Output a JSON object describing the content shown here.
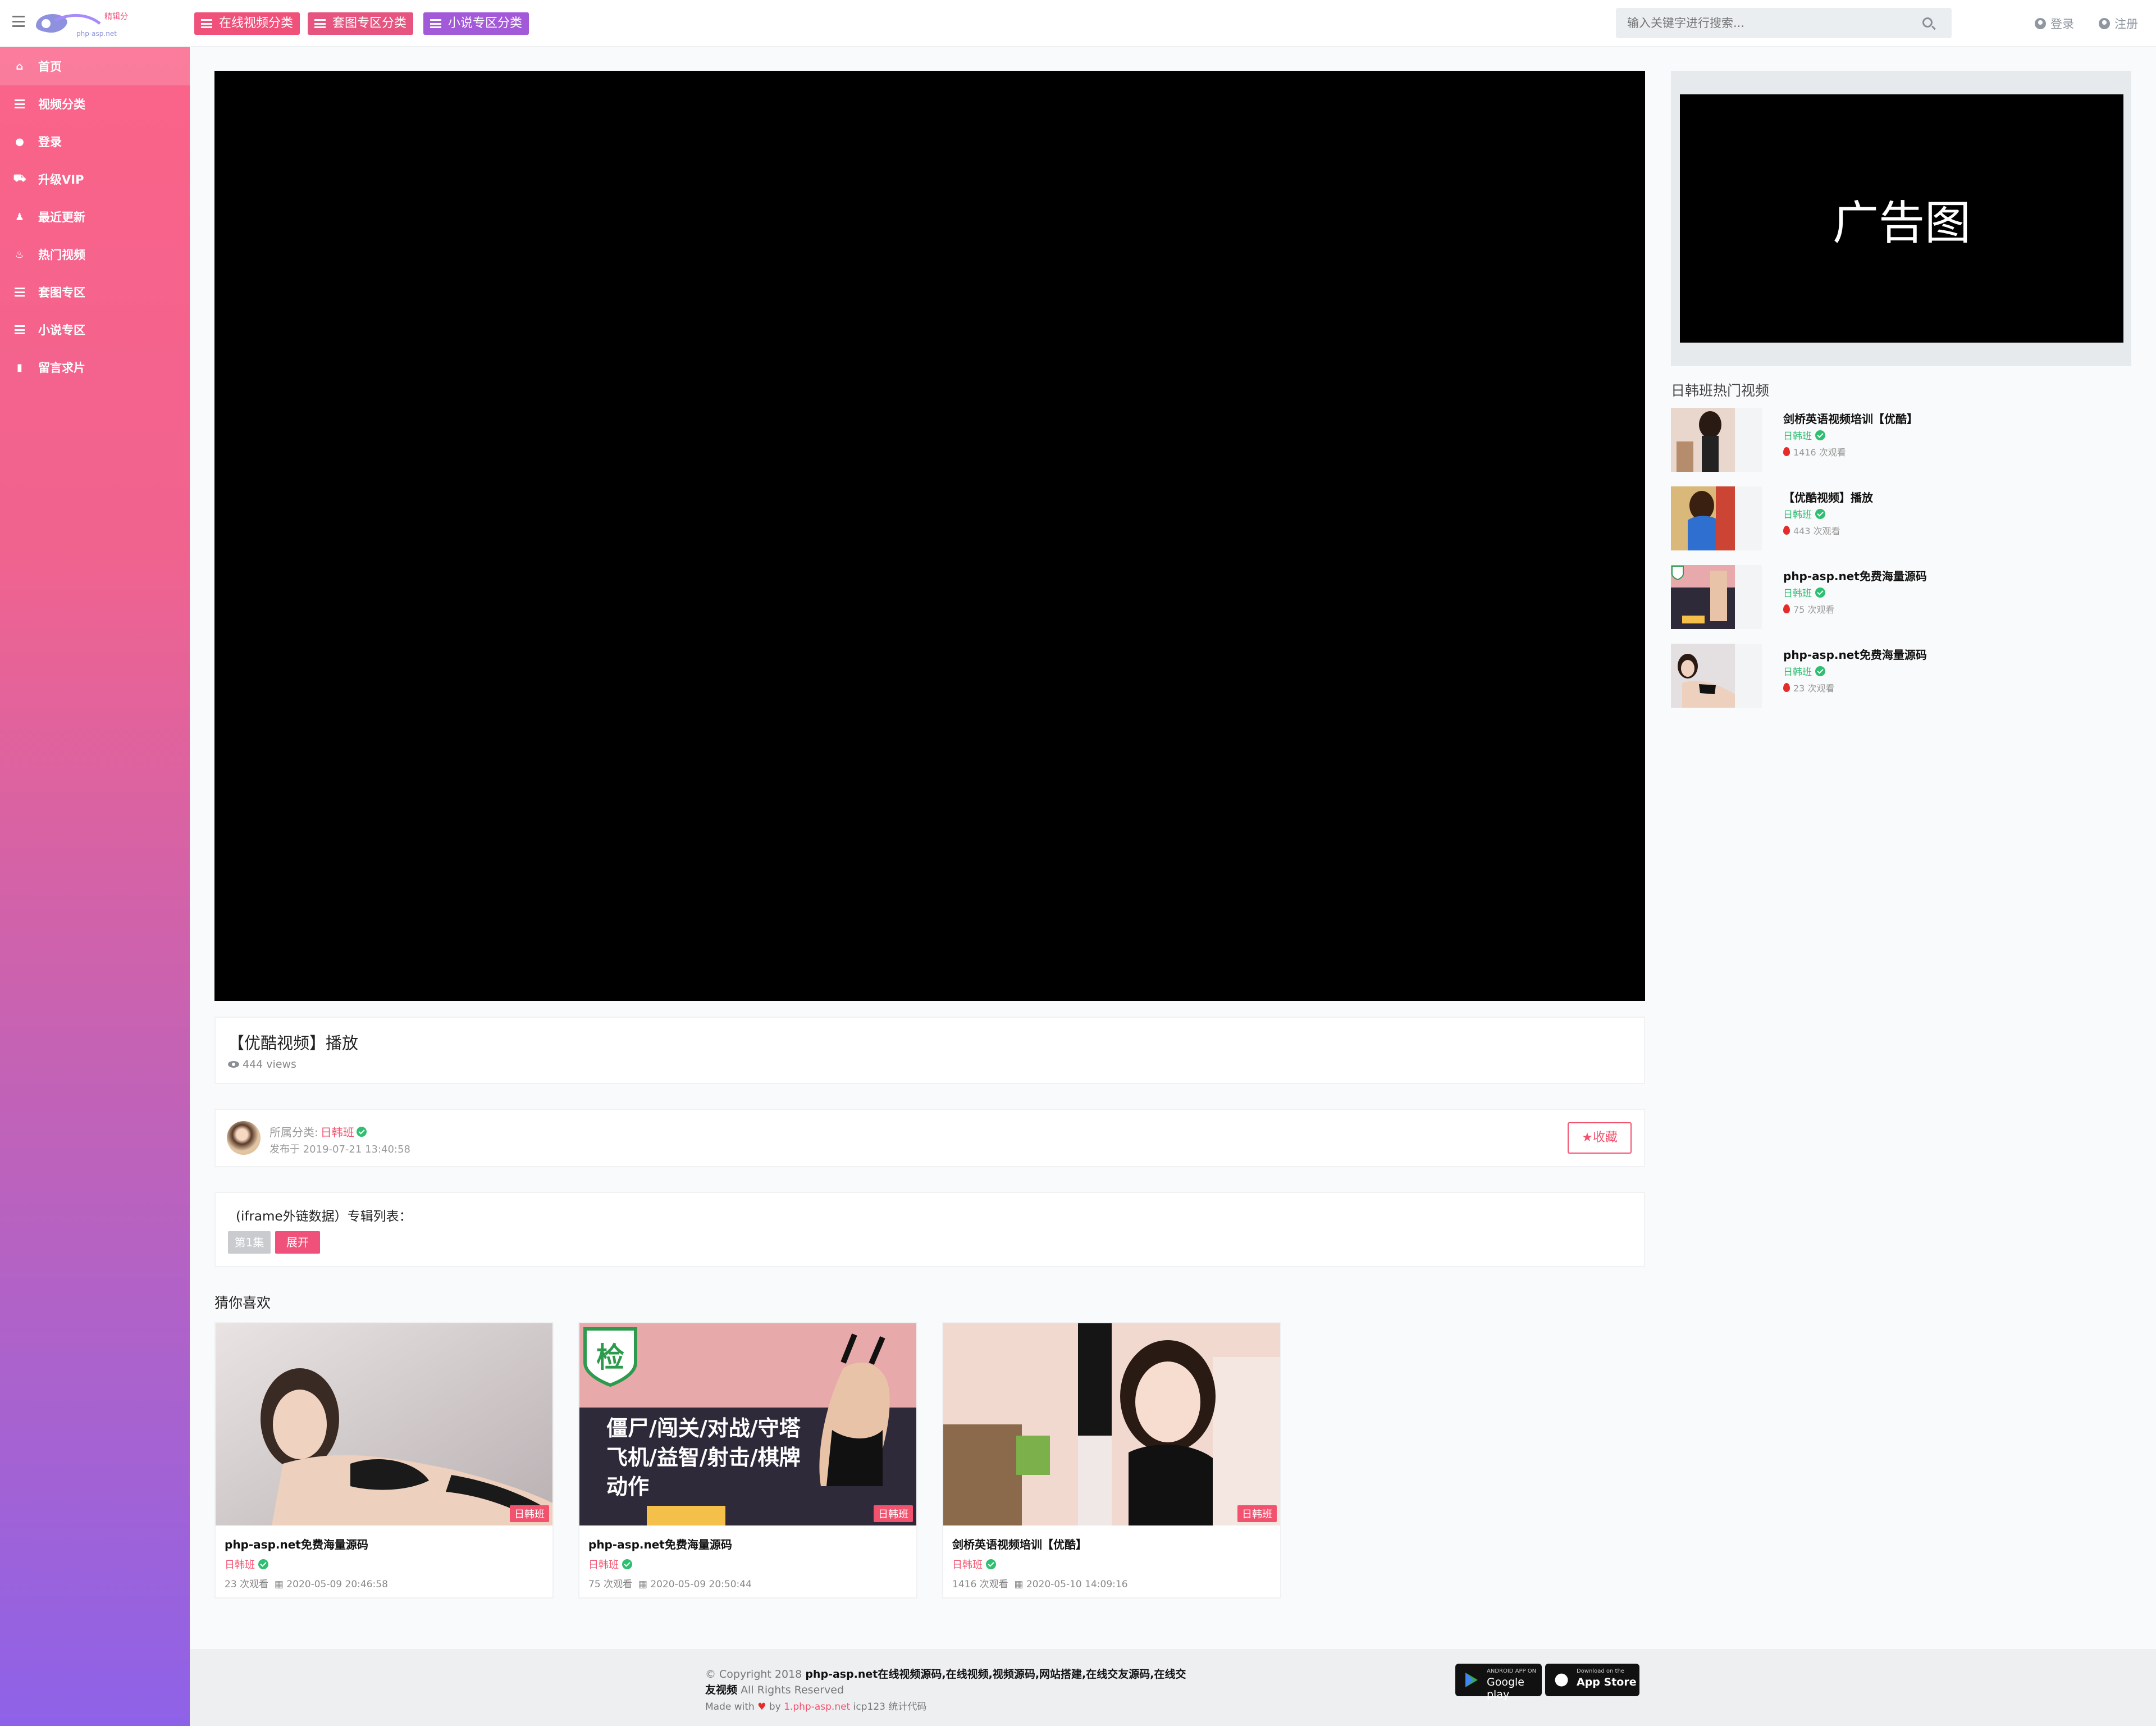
{
  "logo": {
    "text": "php-asp.net",
    "sub": "精辑分类"
  },
  "top_categories": [
    {
      "label": "在线视频分类",
      "color": "#f0517a"
    },
    {
      "label": "套图专区分类",
      "color": "#e6557f"
    },
    {
      "label": "小说专区分类",
      "color": "#a35ad8"
    }
  ],
  "search": {
    "placeholder": "输入关键字进行搜索..."
  },
  "auth": {
    "login": "登录",
    "register": "注册"
  },
  "sidebar": {
    "items": [
      {
        "label": "首页",
        "icon": "home-icon"
      },
      {
        "label": "视频分类",
        "icon": "list-icon"
      },
      {
        "label": "登录",
        "icon": "user-circle-icon"
      },
      {
        "label": "升级VIP",
        "icon": "cart-icon"
      },
      {
        "label": "最近更新",
        "icon": "user-icon"
      },
      {
        "label": "热门视频",
        "icon": "fire-icon"
      },
      {
        "label": "套图专区",
        "icon": "list-icon"
      },
      {
        "label": "小说专区",
        "icon": "list-icon"
      },
      {
        "label": "留言求片",
        "icon": "clipboard-icon"
      }
    ]
  },
  "video": {
    "title": "【优酷视频】播放",
    "views": "444 views",
    "category_label": "所属分类:",
    "category": "日韩班",
    "published": "发布于 2019-07-21 13:40:58",
    "favorite_label": "收藏"
  },
  "episodes": {
    "title": "(iframe外链数据）专辑列表：",
    "buttons": [
      "第1集",
      "展开"
    ]
  },
  "recommend": {
    "title": "猜你喜欢",
    "items": [
      {
        "title": "php-asp.net免费海量源码",
        "category": "日韩班",
        "views": "23 次观看",
        "date": "2020-05-09 20:46:58",
        "tag": "日韩班"
      },
      {
        "title": "php-asp.net免费海量源码",
        "category": "日韩班",
        "views": "75 次观看",
        "date": "2020-05-09 20:50:44",
        "tag": "日韩班",
        "thumb_text": [
          "僵尸/闯关/对战/守塔",
          "飞机/益智/射击/棋牌",
          "动作"
        ],
        "badge": "检"
      },
      {
        "title": "剑桥英语视频培训【优酷】",
        "category": "日韩班",
        "views": "1416 次观看",
        "date": "2020-05-10 14:09:16",
        "tag": "日韩班"
      }
    ]
  },
  "ad": {
    "text": "广告图"
  },
  "hot": {
    "title": "日韩班热门视频",
    "items": [
      {
        "title": "剑桥英语视频培训【优酷】",
        "category": "日韩班",
        "views": "1416 次观看"
      },
      {
        "title": "【优酷视频】播放",
        "category": "日韩班",
        "views": "443 次观看"
      },
      {
        "title": "php-asp.net免费海量源码",
        "category": "日韩班",
        "views": "75 次观看"
      },
      {
        "title": "php-asp.net免费海量源码",
        "category": "日韩班",
        "views": "23 次观看"
      }
    ]
  },
  "footer": {
    "copyright_prefix": "© Copyright 2018",
    "copyright_bold_1": "php-asp.net在线视频源码,在线视频,视频源码,网站搭建,在线交友源码,在线交",
    "copyright_bold_2": "友视频",
    "rights": "All Rights Reserved",
    "made_with": "Made with",
    "by": "by",
    "link": "1.php-asp.net",
    "tail": "icp123 统计代码",
    "google_small": "ANDROID APP ON",
    "google_big": "Google play",
    "apple_small": "Download on the",
    "apple_big": "App Store"
  }
}
